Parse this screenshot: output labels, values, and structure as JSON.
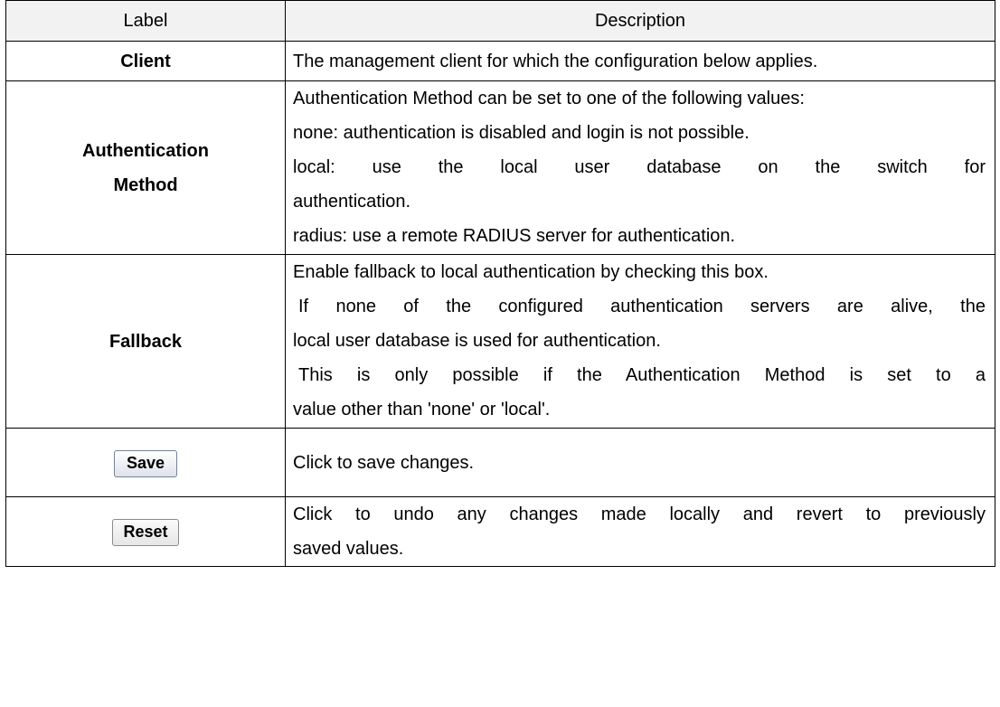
{
  "header": {
    "label": "Label",
    "description": "Description"
  },
  "rows": [
    {
      "label": "Client",
      "lines": [
        "The management client for which the configuration below applies."
      ]
    },
    {
      "label_line1": "Authentication",
      "label_line2": "Method",
      "lines": [
        "Authentication Method can be set to one of the following values:",
        "none: authentication is disabled and login is not possible.",
        "local:  use  the  local  user  database  on  the  switch   for",
        "authentication.",
        "radius: use a remote RADIUS server for authentication."
      ]
    },
    {
      "label": "Fallback",
      "lines": [
        "Enable fallback to local authentication by checking this box.",
        "If none of the configured authentication servers are alive, the",
        "local user database is used for authentication.",
        "This is only possible if the Authentication Method is set to a",
        "value other than 'none' or 'local'."
      ]
    },
    {
      "button": "Save",
      "lines": [
        "Click to save changes."
      ]
    },
    {
      "button": "Reset",
      "lines": [
        "Click to undo any changes made locally and revert to previously",
        "saved values."
      ]
    }
  ]
}
